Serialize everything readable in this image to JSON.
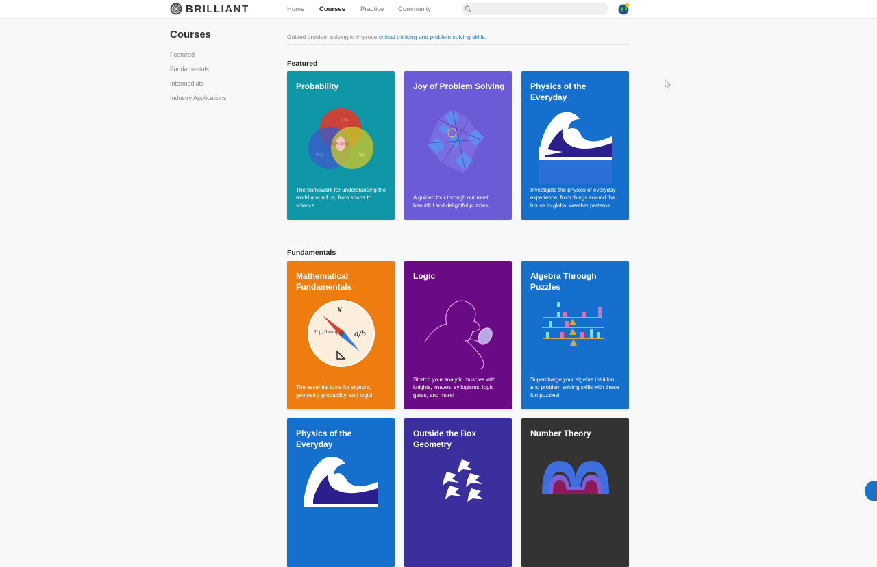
{
  "header": {
    "brand": "BRILLIANT",
    "nav": [
      "Home",
      "Courses",
      "Practice",
      "Community"
    ],
    "search_placeholder": ""
  },
  "sidebar": {
    "title": "Courses",
    "items": [
      "Featured",
      "Fundamentals",
      "Intermediate",
      "Industry Applications"
    ]
  },
  "intro": {
    "text": "Guided problem solving to improve ",
    "link": "critical thinking and problem solving skills."
  },
  "sections": {
    "featured": {
      "title": "Featured",
      "cards": [
        {
          "title": "Probability",
          "desc": "The framework for understanding the world around us, from sports to science.",
          "color": "#0f97a8",
          "icon": "venn-diagram-icon"
        },
        {
          "title": "Joy of Problem Solving",
          "desc": "A guided tour through our most beautiful and delightful puzzles.",
          "color": "#6b5bd6",
          "icon": "polyhedron-puzzle-icon"
        },
        {
          "title": "Physics of the Everyday",
          "desc": "Investigate the physics of everyday experience, from things around the house to global weather patterns.",
          "color": "#1470cc",
          "icon": "great-wave-icon"
        }
      ]
    },
    "fundamentals": {
      "title": "Fundamentals",
      "cards": [
        {
          "title": "Mathematical Fundamentals",
          "desc": "The essential tools for algebra, geometry, probability, and logic!",
          "color": "#ef7c0e",
          "icon": "compass-icon",
          "art_text": {
            "top": "x",
            "right": "a/b",
            "left": "If p, then q."
          }
        },
        {
          "title": "Logic",
          "desc": "Stretch your analytic muscles with knights, knaves, syllogisms, logic gates, and more!",
          "color": "#6b0a85",
          "icon": "detective-magnifier-icon"
        },
        {
          "title": "Algebra Through Puzzles",
          "desc": "Supercharge your algebra intuition and problem solving skills with these fun puzzles!",
          "color": "#1470cc",
          "icon": "balance-scale-icon"
        },
        {
          "title": "Physics of the Everyday",
          "desc": "",
          "color": "#1470cc",
          "icon": "great-wave-icon"
        },
        {
          "title": "Outside the Box Geometry",
          "desc": "",
          "color": "#3a2f9c",
          "icon": "paper-birds-icon"
        },
        {
          "title": "Number Theory",
          "desc": "",
          "color": "#333333",
          "icon": "infinity-knot-icon"
        }
      ]
    }
  },
  "venn_labels": {
    "a": "P(A)",
    "b": "P(B)",
    "c": "P(C)",
    "center": "P(A∩B∩C)"
  }
}
